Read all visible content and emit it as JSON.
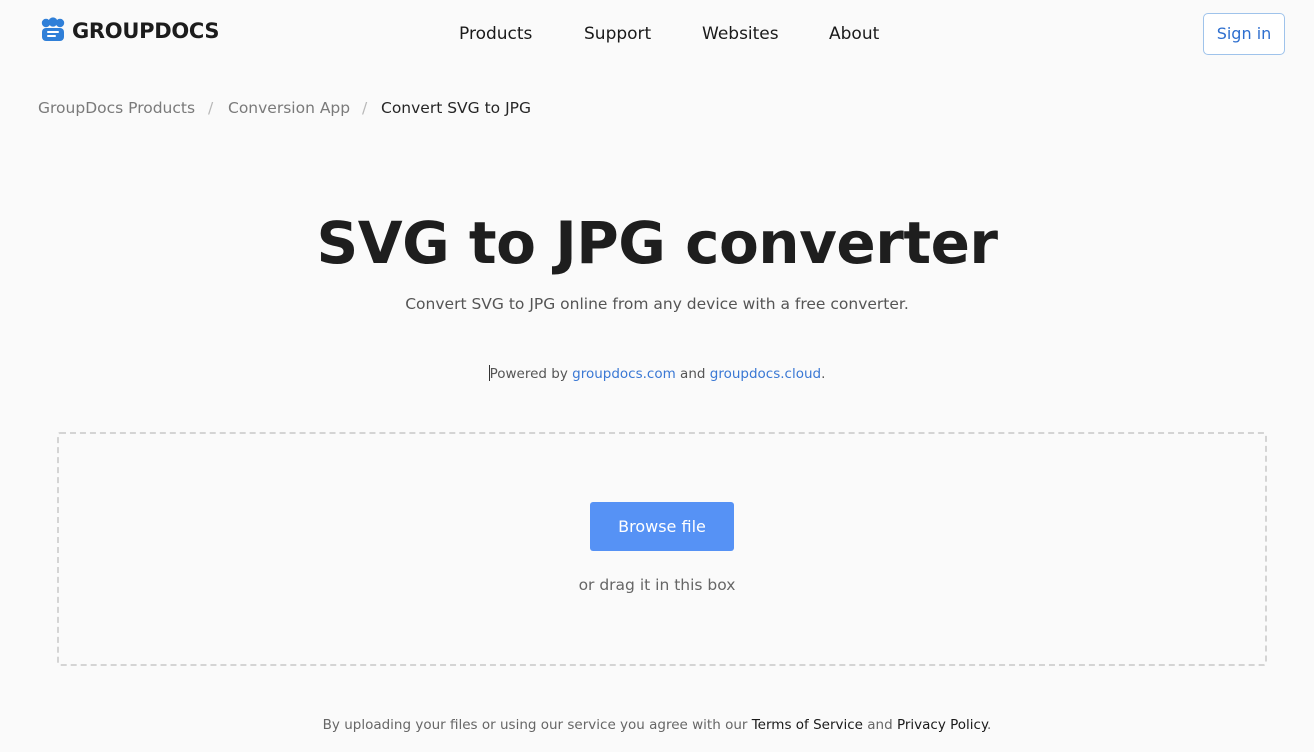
{
  "brand": {
    "name": "GROUPDOCS",
    "logo_icon": "groupdocs-logo-icon",
    "color": "#2f7fd8"
  },
  "nav": {
    "items": [
      {
        "label": "Products"
      },
      {
        "label": "Support"
      },
      {
        "label": "Websites"
      },
      {
        "label": "About"
      }
    ],
    "signin_label": "Sign in"
  },
  "breadcrumb": {
    "items": [
      "GroupDocs Products",
      "Conversion App",
      "Convert SVG to JPG"
    ],
    "separator": "/"
  },
  "hero": {
    "title": "SVG to JPG converter",
    "subtitle": "Convert SVG to JPG online from any device with a free converter."
  },
  "powered": {
    "prefix": "Powered by ",
    "link1": "groupdocs.com",
    "middle": " and ",
    "link2": "groupdocs.cloud",
    "suffix": "."
  },
  "upload": {
    "button_label": "Browse file",
    "drag_text": "or drag it in this box",
    "accent": "#5692f5"
  },
  "footer": {
    "prefix": "By uploading your files or using our service you agree with our ",
    "terms": "Terms of Service",
    "middle": " and ",
    "privacy": "Privacy Policy",
    "suffix": "."
  }
}
